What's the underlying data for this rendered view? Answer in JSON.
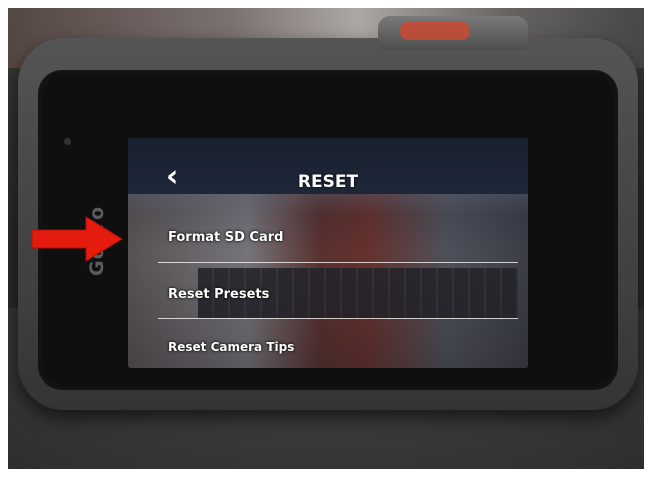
{
  "screen": {
    "title": "RESET",
    "back_icon": "chevron-left-icon",
    "menu_items": [
      {
        "label": "Format SD Card"
      },
      {
        "label": "Reset Presets"
      },
      {
        "label": "Reset Camera Tips"
      }
    ]
  },
  "device": {
    "brand_logo": "GoPro"
  },
  "annotation": {
    "arrow_icon": "red-arrow-icon",
    "arrow_color": "#e51c0d",
    "points_to": "Format SD Card"
  }
}
